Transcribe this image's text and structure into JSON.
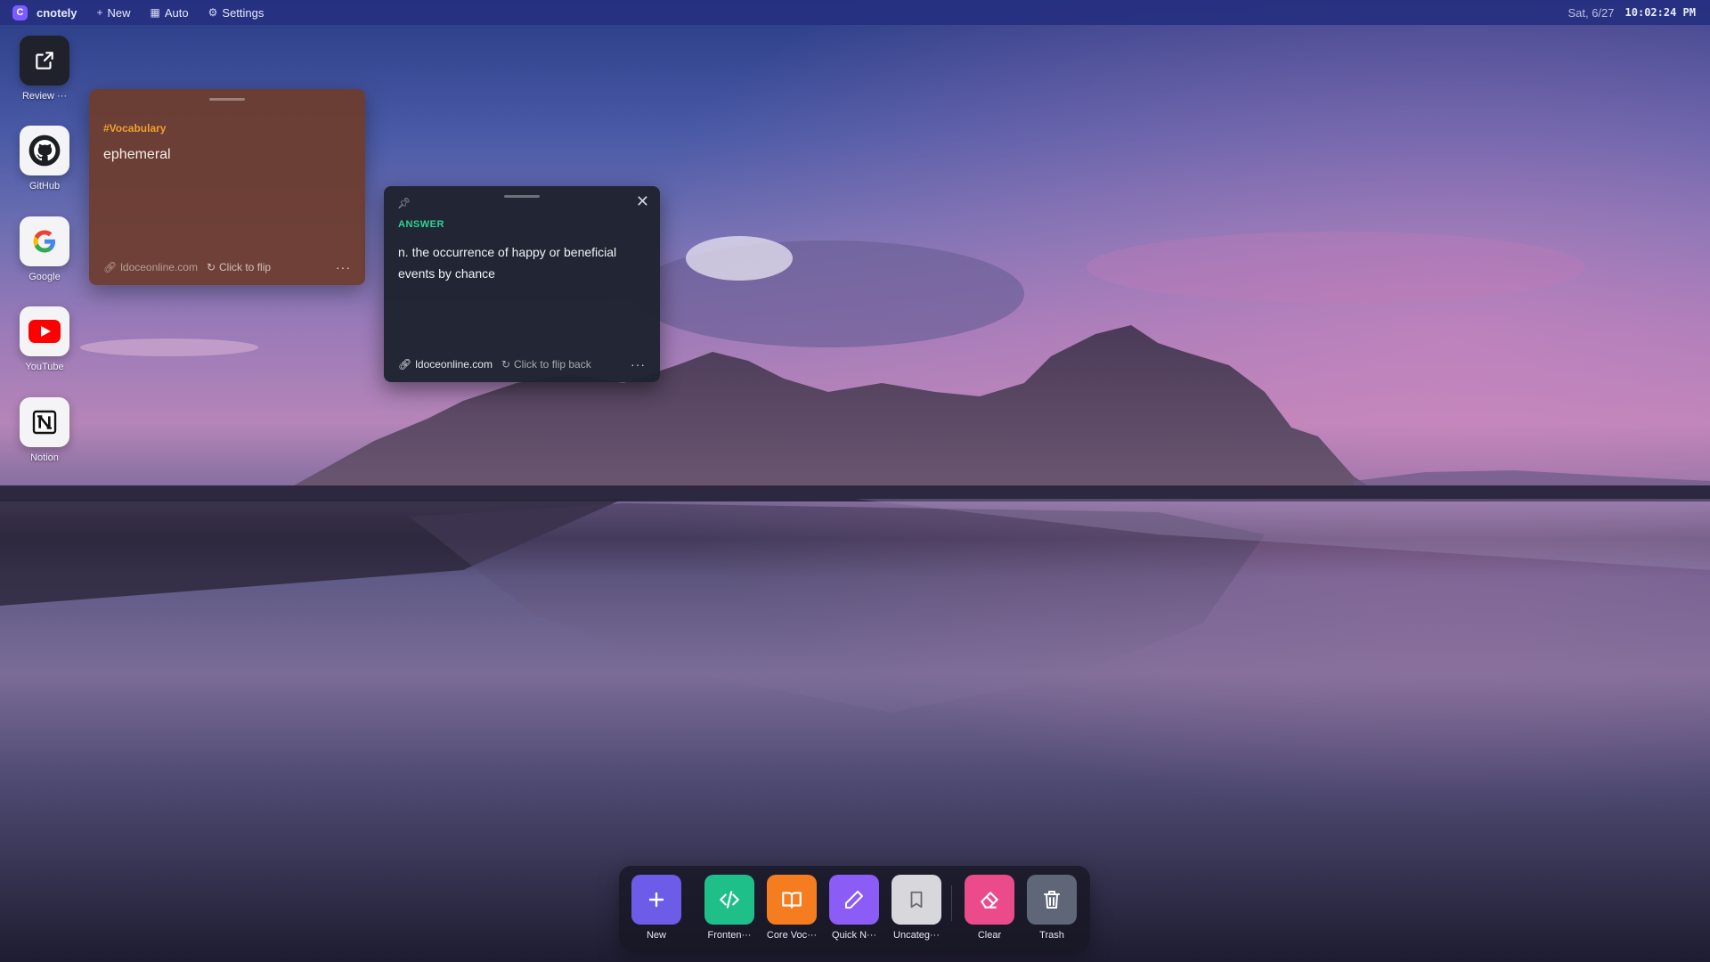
{
  "topbar": {
    "brand_letter": "C",
    "brand_name": "cnotely",
    "new_label": "New",
    "auto_label": "Auto",
    "settings_label": "Settings",
    "date": "Sat, 6/27",
    "time": "10:02:24 PM"
  },
  "shortcuts": [
    {
      "label": "Review ···",
      "icon": "share-icon"
    },
    {
      "label": "GitHub",
      "icon": "github-icon"
    },
    {
      "label": "Google",
      "icon": "google-icon"
    },
    {
      "label": "YouTube",
      "icon": "youtube-icon"
    },
    {
      "label": "Notion",
      "icon": "notion-icon"
    }
  ],
  "card_front": {
    "tag": "#Vocabulary",
    "word": "ephemeral",
    "source": "ldoceonline.com",
    "flip_label": "Click to flip",
    "more": "···"
  },
  "card_back": {
    "answer_label": "ANSWER",
    "answer_text": "n. the occurrence of happy or beneficial events by chance",
    "source": "ldoceonline.com",
    "flip_label": "Click to flip back",
    "more": "···"
  },
  "dock": [
    {
      "label": "New",
      "icon": "plus-icon",
      "color": "#6c5ce7"
    },
    {
      "label": "Fronten···",
      "icon": "code-icon",
      "color": "#1fbf8a"
    },
    {
      "label": "Core Voc···",
      "icon": "book-icon",
      "color": "#f57c1f"
    },
    {
      "label": "Quick N···",
      "icon": "pencil-icon",
      "color": "#8b5cf6"
    },
    {
      "label": "Uncateg···",
      "icon": "bookmark-icon",
      "color": "#d8d8dc"
    },
    {
      "label": "Clear",
      "icon": "eraser-icon",
      "color": "#ec4b8b"
    },
    {
      "label": "Trash",
      "icon": "trash-icon",
      "color": "#5e6678"
    }
  ],
  "colors": {
    "accent": "#7c5cff",
    "topbar": "#263080",
    "answer": "#2ed396",
    "tag": "#f0a030"
  }
}
